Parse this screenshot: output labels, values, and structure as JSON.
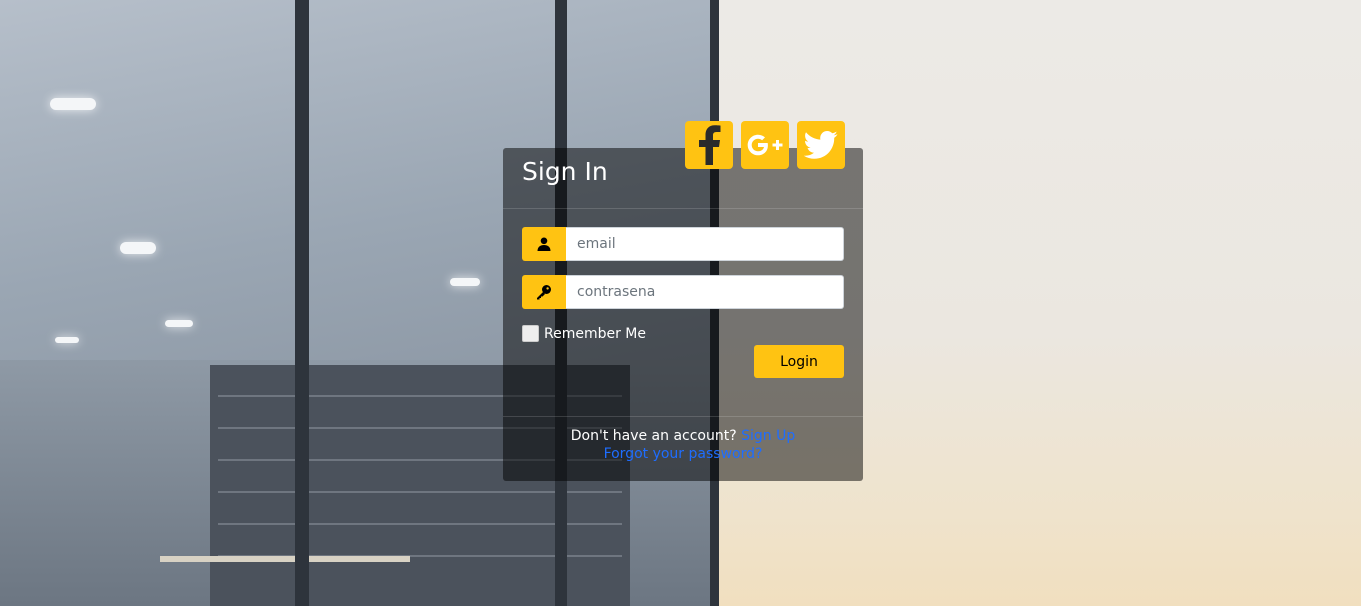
{
  "social": {
    "facebook_icon": "facebook-icon",
    "google_plus_icon": "google-plus-icon",
    "twitter_icon": "twitter-icon",
    "accent_color": "#ffc312"
  },
  "card": {
    "title": "Sign In",
    "email_placeholder": "email",
    "password_placeholder": "contrasena",
    "user_icon": "user-icon",
    "key_icon": "key-icon",
    "remember_label": "Remember Me",
    "login_label": "Login"
  },
  "footer": {
    "no_account_text": "Don't have an account?",
    "signup_link": "Sign Up",
    "forgot_link": "Forgot your password?",
    "link_color": "#1e6dff"
  }
}
